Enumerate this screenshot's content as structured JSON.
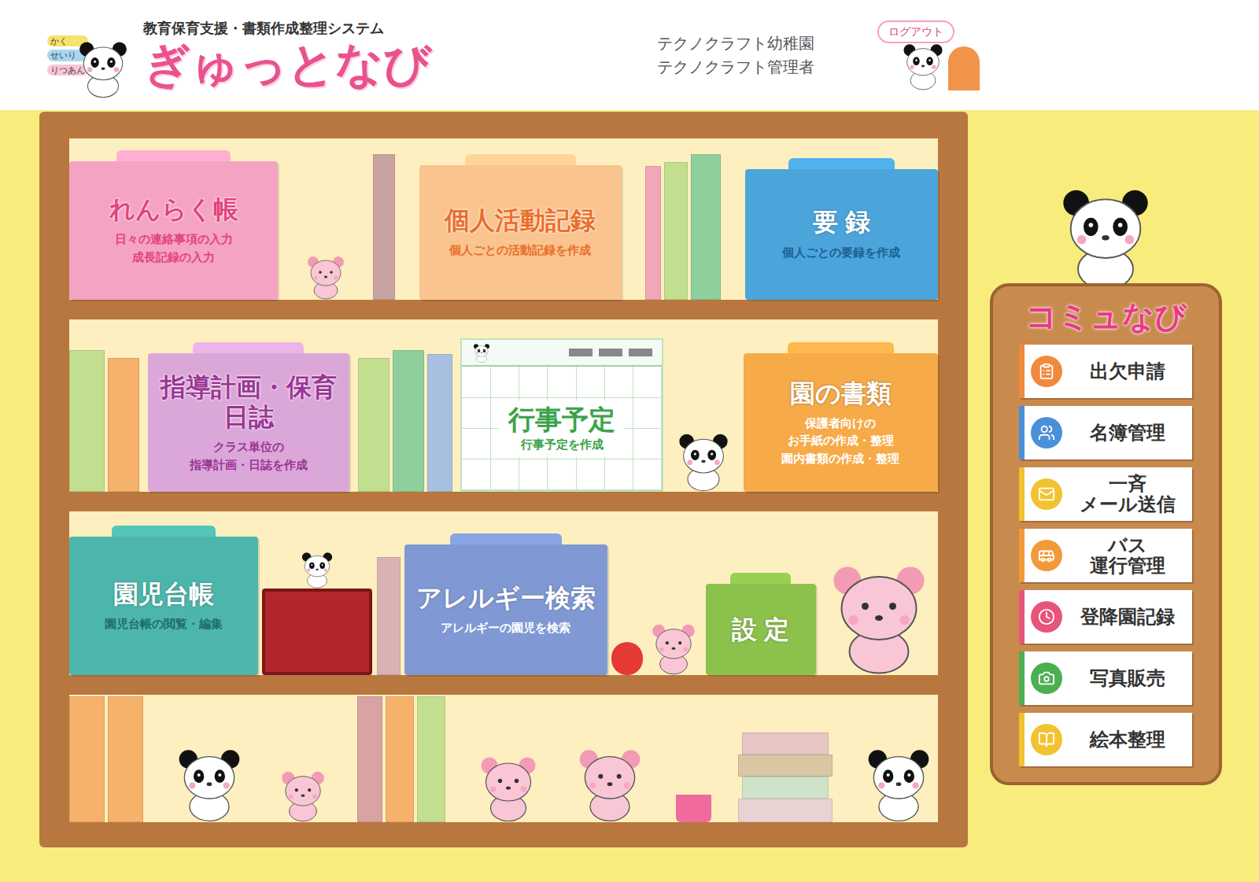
{
  "header": {
    "bubbles": [
      "かく",
      "せいり",
      "りつあん"
    ],
    "subtitle": "教育保育支援・書類作成整理システム",
    "logo": "ぎゅっとなび",
    "school": "テクノクラフト幼稚園",
    "user": "テクノクラフト管理者",
    "logout": "ログアウト"
  },
  "shelves": [
    {
      "items": [
        {
          "kind": "folder",
          "title": "れんらく帳",
          "lines": [
            "日々の連絡事項の入力",
            "成長記録の入力"
          ],
          "color": "#f5a3c2",
          "title_color": "#e2447c",
          "text_color": "#e2447c"
        },
        {
          "kind": "folder",
          "title": "個人活動記録",
          "lines": [
            "個人ごとの活動記録を作成"
          ],
          "color": "#f9c48e",
          "title_color": "#ea6e2a",
          "text_color": "#ea6e2a"
        },
        {
          "kind": "folder",
          "title": "要 録",
          "lines": [
            "個人ごとの要録を作成"
          ],
          "color": "#4ba5db",
          "title_color": "#ffffff",
          "text_color": "#1d5f93"
        }
      ]
    },
    {
      "items": [
        {
          "kind": "folder",
          "title": "指導計画・保育日誌",
          "lines": [
            "クラス単位の",
            "指導計画・日誌を作成"
          ],
          "color": "#dba7d8",
          "title_color": "#9a3595",
          "text_color": "#9a3595"
        },
        {
          "kind": "calendar",
          "title": "行事予定",
          "lines": [
            "行事予定を作成"
          ],
          "color": "#ffffff",
          "title_color": "#3aa348",
          "text_color": "#3aa348"
        },
        {
          "kind": "folder",
          "title": "園の書類",
          "lines": [
            "保護者向けの",
            "お手紙の作成・整理",
            "園内書類の作成・整理"
          ],
          "color": "#f6aa48",
          "title_color": "#ffffff",
          "text_color": "#ffffff"
        }
      ]
    },
    {
      "items": [
        {
          "kind": "folder",
          "title": "園児台帳",
          "lines": [
            "園児台帳の閲覧・編集"
          ],
          "color": "#4db6ac",
          "title_color": "#ffffff",
          "text_color": "#1f6f69"
        },
        {
          "kind": "folder",
          "title": "アレルギー検索",
          "lines": [
            "アレルギーの園児を検索"
          ],
          "color": "#8099d4",
          "title_color": "#ffffff",
          "text_color": "#ffffff"
        },
        {
          "kind": "folder",
          "title": "設 定",
          "lines": [],
          "color": "#8cc14c",
          "title_color": "#ffffff",
          "text_color": "#ffffff"
        }
      ]
    }
  ],
  "commu": {
    "title": "コミュなび",
    "items": [
      {
        "lines": [
          "出欠申請"
        ],
        "color": "#f08a3c"
      },
      {
        "lines": [
          "名簿管理"
        ],
        "color": "#4a90d9"
      },
      {
        "lines": [
          "一斉",
          "メール送信"
        ],
        "color": "#f2c230"
      },
      {
        "lines": [
          "バス",
          "運行管理"
        ],
        "color": "#f29a3a"
      },
      {
        "lines": [
          "登降園記録"
        ],
        "color": "#e8557a"
      },
      {
        "lines": [
          "写真販売"
        ],
        "color": "#4caf50"
      },
      {
        "lines": [
          "絵本整理"
        ],
        "color": "#f2c230"
      }
    ]
  }
}
